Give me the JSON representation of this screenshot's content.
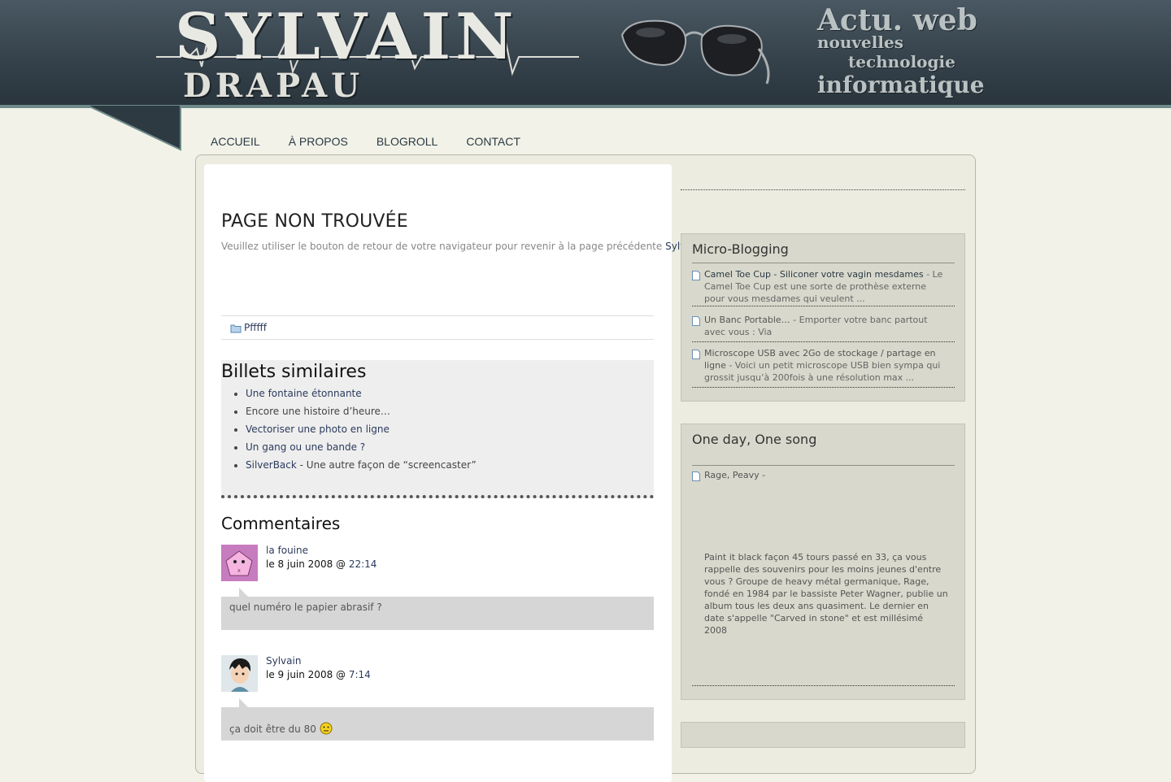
{
  "header": {
    "logo_line1": "SYLVAIN",
    "logo_line2": "DRAPAU",
    "tagline": [
      "Actu. web",
      "nouvelles",
      "technologie",
      "informatique"
    ]
  },
  "nav": [
    "ACCUEIL",
    "À PROPOS",
    "BLOGROLL",
    "CONTACT"
  ],
  "main": {
    "title": "PAGE NON TROUVÉE",
    "message": "Veuillez utiliser le bouton de retour de votre navigateur pour revenir à la page précédente",
    "message_link": "Sylvain",
    "category": "Pfffff",
    "similar_title": "Billets similaires",
    "similar": [
      {
        "text": "Une fontaine étonnante",
        "link": true
      },
      {
        "text": "Encore une histoire d’heure…",
        "link": false
      },
      {
        "text": "Vectoriser une photo en ligne",
        "link": true
      },
      {
        "text": "Un gang ou une bande ?",
        "link": true
      },
      {
        "text": "SilverBack",
        "link": true,
        "suffix": " - Une autre façon de “screencaster”"
      }
    ],
    "comments_title": "Commentaires",
    "comments": [
      {
        "author": "la fouine",
        "date": "le 8 juin 2008 @ ",
        "time": "22:14",
        "text": "quel numéro le papier abrasif ?"
      },
      {
        "author": "Sylvain",
        "date": "le 9 juin 2008 @ ",
        "time": "7:14",
        "text": "ça doit être du 80 "
      }
    ]
  },
  "sidebar": {
    "microblog_title": "Micro-Blogging",
    "microblog": [
      {
        "title": "Camel Toe Cup - Siliconer votre vagin mesdames",
        "desc": " - Le Camel Toe Cup est une sorte de prothèse externe pour vous mesdames qui veulent ..."
      },
      {
        "title": "Un Banc Portable…",
        "desc": " - Emporter votre banc partout avec vous : Via"
      },
      {
        "title": "Microscope USB avec 2Go de stockage / partage en ligne",
        "desc": " - Voici un petit microscope USB bien sympa qui grossit jusqu’à 200fois à une résolution max ..."
      }
    ],
    "song_title": "One day, One song",
    "song_item": "Rage, Peavy -",
    "song_desc": "Paint it black façon 45 tours passé en 33, ça vous rappelle des souvenirs pour les moins jeunes d'entre vous ? Groupe de heavy métal germanique, Rage, fondé en 1984 par le bassiste Peter Wagner, publie un album tous les deux ans quasiment. Le dernier en date s'appelle \"Carved in stone\" et est millésimé 2008"
  },
  "colors": {
    "header": "#35424b",
    "page_bg": "#f2f2e8",
    "link": "#2b3a5c",
    "widget": "#d8d8cc"
  }
}
